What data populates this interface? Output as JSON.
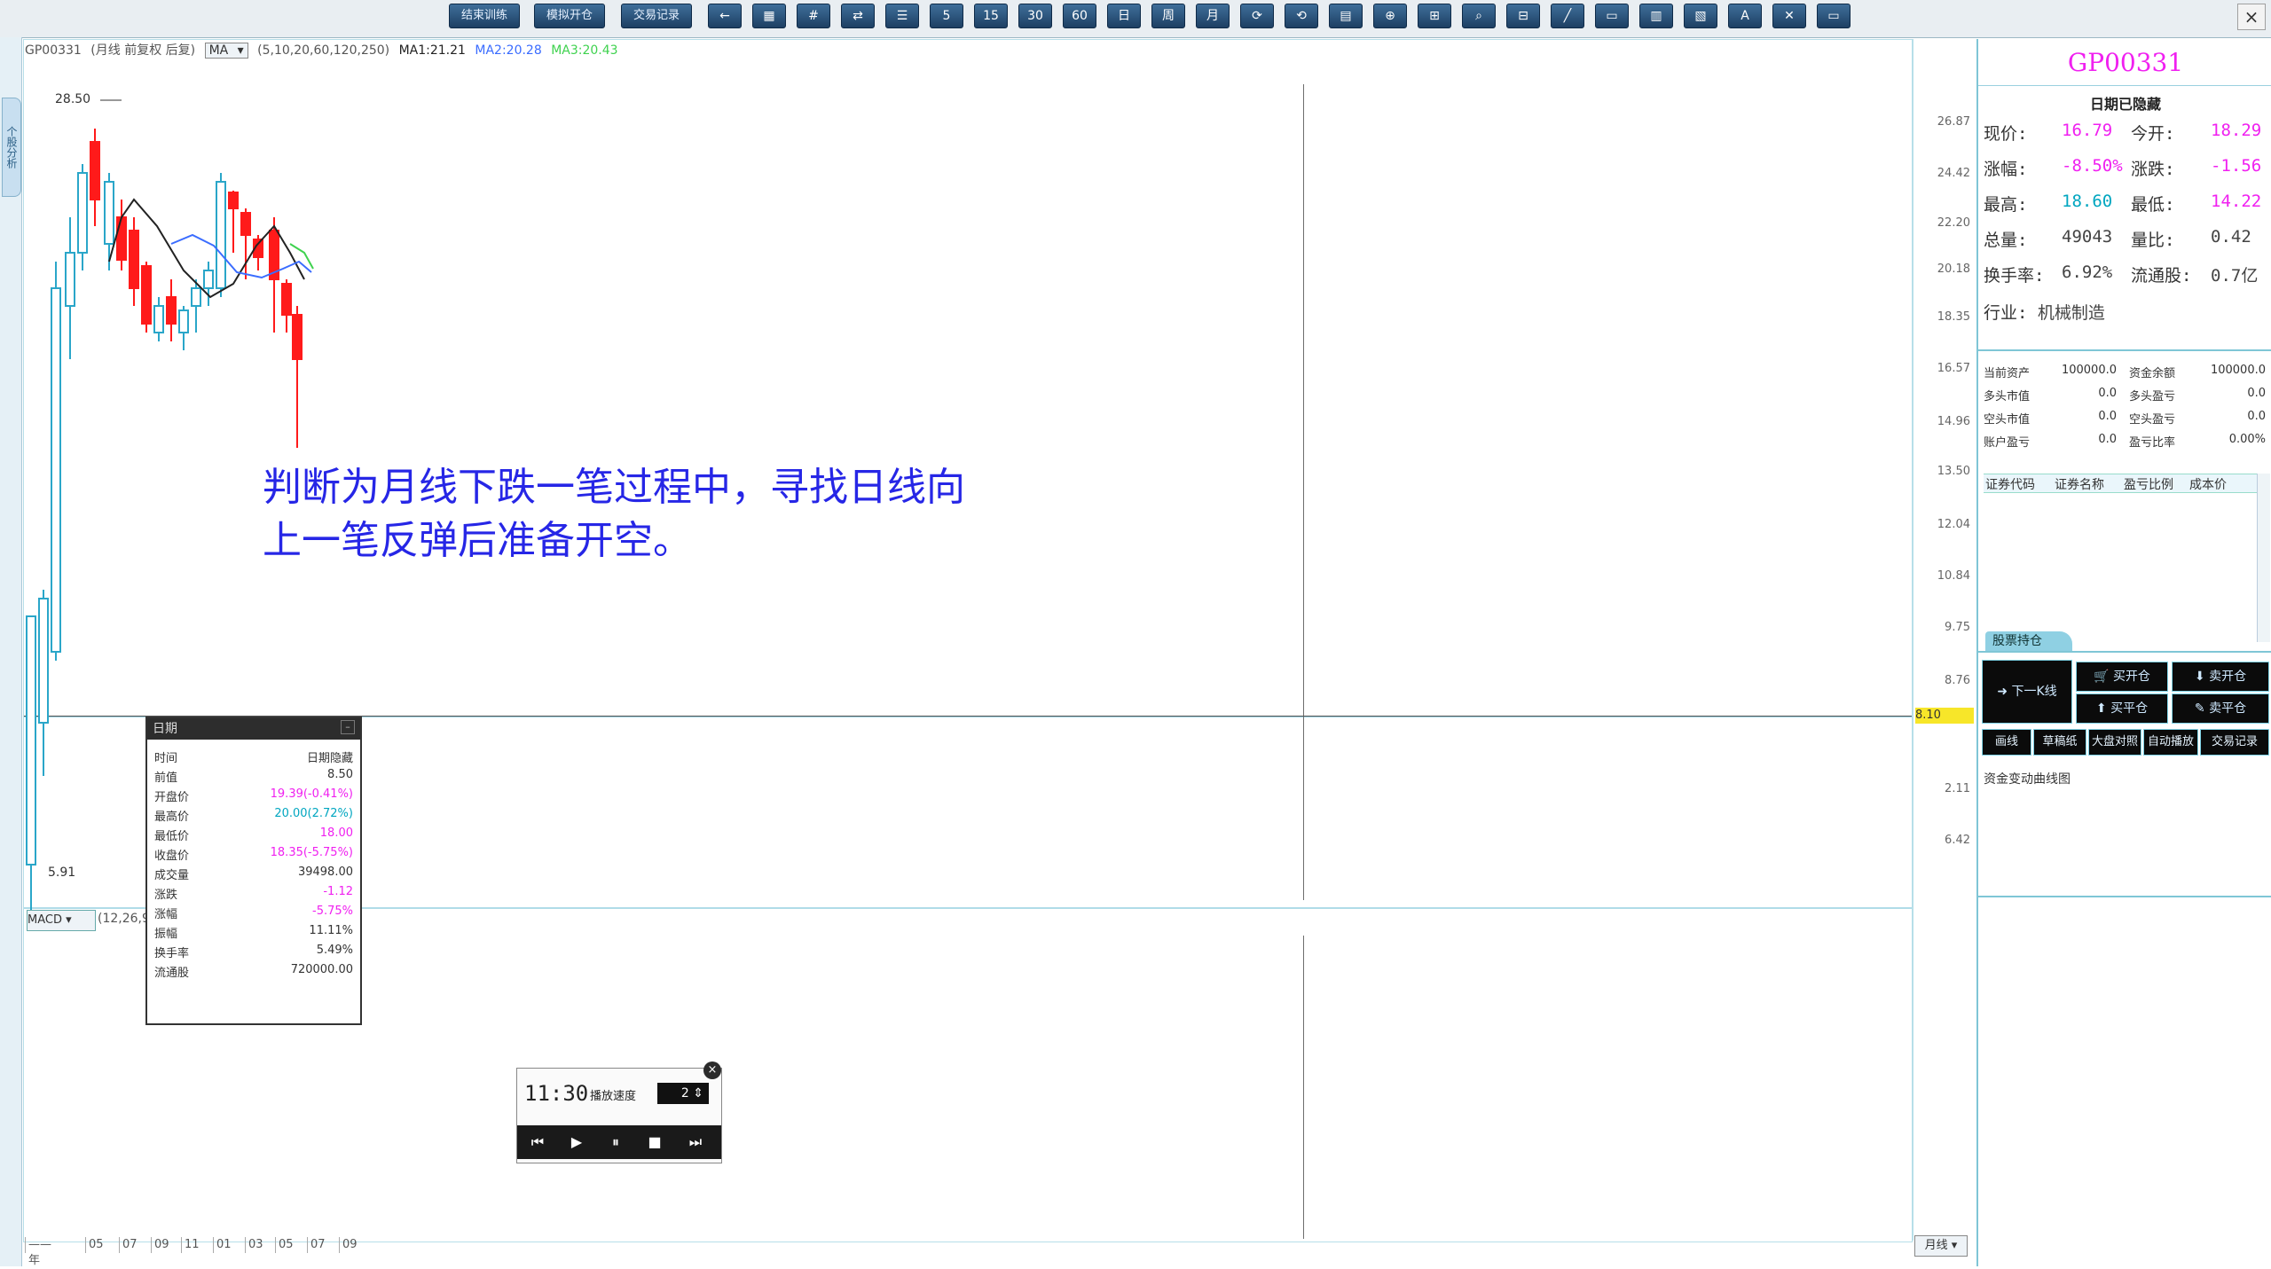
{
  "toolbar": {
    "buttons": [
      "结束训练",
      "模拟开仓",
      "交易记录"
    ],
    "icon_glyphs": [
      "←",
      "▦",
      "#",
      "⇄",
      "☰",
      "5",
      "15",
      "30",
      "60",
      "日",
      "周",
      "月",
      "⟳",
      "⟲",
      "▤",
      "⊕",
      "⊞",
      "⌕",
      "⊟",
      "╱",
      "▭",
      "▥",
      "▧",
      "A",
      "✕",
      "▭"
    ],
    "close_glyph": "×"
  },
  "left_tab": {
    "label": "个股分析"
  },
  "chart": {
    "info": {
      "code": "GP00331",
      "desc": "(月线 前复权 后复)",
      "ma_select": "MA",
      "ma_params": "(5,10,20,60,120,250)",
      "ma1": "MA1:21.21",
      "ma2": "MA2:20.28",
      "ma3": "MA3:20.43"
    },
    "high_label": "28.50",
    "low_label": "5.91",
    "colors": {
      "up": "#ff1a1a",
      "down": "#d01010",
      "ma1": "#222222",
      "ma2": "#3a6cff",
      "ma3": "#3fd24f",
      "grid": "#b9e2ec"
    }
  },
  "y_axis": {
    "ticks": [
      "26.87",
      "24.42",
      "22.20",
      "20.18",
      "18.35",
      "16.57",
      "14.96",
      "13.50",
      "12.04",
      "10.84",
      "9.75",
      "8.76",
      "2.11",
      "6.42"
    ],
    "current": "8.10"
  },
  "annotation": {
    "line1": "判断为月线下跌一笔过程中，寻找日线向",
    "line2": "上一笔反弹后准备开空。"
  },
  "popup": {
    "title": "日期",
    "rows": [
      {
        "k": "时间",
        "v": "日期隐藏",
        "color": "#333333"
      },
      {
        "k": "前值",
        "v": "8.50",
        "color": "#333333"
      },
      {
        "k": "开盘价",
        "v": "19.39(-0.41%)",
        "color": "#f020f0"
      },
      {
        "k": "最高价",
        "v": "20.00(2.72%)",
        "color": "#00a6c0"
      },
      {
        "k": "最低价",
        "v": "18.00",
        "color": "#f020f0"
      },
      {
        "k": "收盘价",
        "v": "18.35(-5.75%)",
        "color": "#f020f0"
      },
      {
        "k": "成交量",
        "v": "39498.00",
        "color": "#333333"
      },
      {
        "k": "涨跌",
        "v": "-1.12",
        "color": "#f020f0"
      },
      {
        "k": "涨幅",
        "v": "-5.75%",
        "color": "#f020f0"
      },
      {
        "k": "振幅",
        "v": "11.11%",
        "color": "#333333"
      },
      {
        "k": "换手率",
        "v": "5.49%",
        "color": "#333333"
      },
      {
        "k": "流通股",
        "v": "720000.00",
        "color": "#333333"
      }
    ]
  },
  "player": {
    "time": "11:30",
    "speed_label": "播放速度",
    "speed": "2",
    "close": "×",
    "buttons": [
      "⏮",
      "▶",
      "⏸",
      "■",
      "⏭"
    ]
  },
  "macd": {
    "select": "MACD",
    "params": "(12,26,9)"
  },
  "date_axis": {
    "cells": [
      "——年",
      "05",
      "07",
      "09",
      "11",
      "01",
      "03",
      "05",
      "07",
      "09"
    ]
  },
  "period_select": "月线",
  "right_panel": {
    "code": "GP00331",
    "subtitle": "日期已隐藏",
    "quotes": [
      {
        "l1": "现价:",
        "v1": "16.79",
        "c1": "qpink",
        "l2": "今开:",
        "v2": "18.29",
        "c2": "qpink"
      },
      {
        "l1": "涨幅:",
        "v1": "-8.50%",
        "c1": "qpink",
        "l2": "涨跌:",
        "v2": "-1.56",
        "c2": "qpink"
      },
      {
        "l1": "最高:",
        "v1": "18.60",
        "c1": "qcyan",
        "l2": "最低:",
        "v2": "14.22",
        "c2": "qpink"
      },
      {
        "l1": "总量:",
        "v1": "49043",
        "c1": "qgray",
        "l2": "量比:",
        "v2": "0.42",
        "c2": "qgray"
      },
      {
        "l1": "换手率:",
        "v1": "6.92%",
        "c1": "qgray",
        "l2": "流通股:",
        "v2": "0.7亿",
        "c2": "qgray"
      }
    ],
    "industry_label": "行业:",
    "industry": "机械制造",
    "account": [
      {
        "a": "当前资产",
        "b": "100000.0",
        "c": "资金余额",
        "d": "100000.0"
      },
      {
        "a": "多头市值",
        "b": "0.0",
        "c": "多头盈亏",
        "d": "0.0"
      },
      {
        "a": "空头市值",
        "b": "0.0",
        "c": "空头盈亏",
        "d": "0.0"
      },
      {
        "a": "账户盈亏",
        "b": "0.0",
        "c": "盈亏比率",
        "d": "0.00%"
      }
    ],
    "pos_headers": [
      "证券代码",
      "证券名称",
      "盈亏比例",
      "成本价"
    ],
    "pos_tab": "股票持仓",
    "next_button": "下一K线",
    "trade_buttons": [
      "买开仓",
      "卖开仓",
      "买平仓",
      "卖平仓"
    ],
    "bottom_tabs": [
      "画线",
      "草稿纸",
      "大盘对照",
      "自动播放",
      "交易记录"
    ],
    "fund_curve": "资金变动曲线图"
  }
}
